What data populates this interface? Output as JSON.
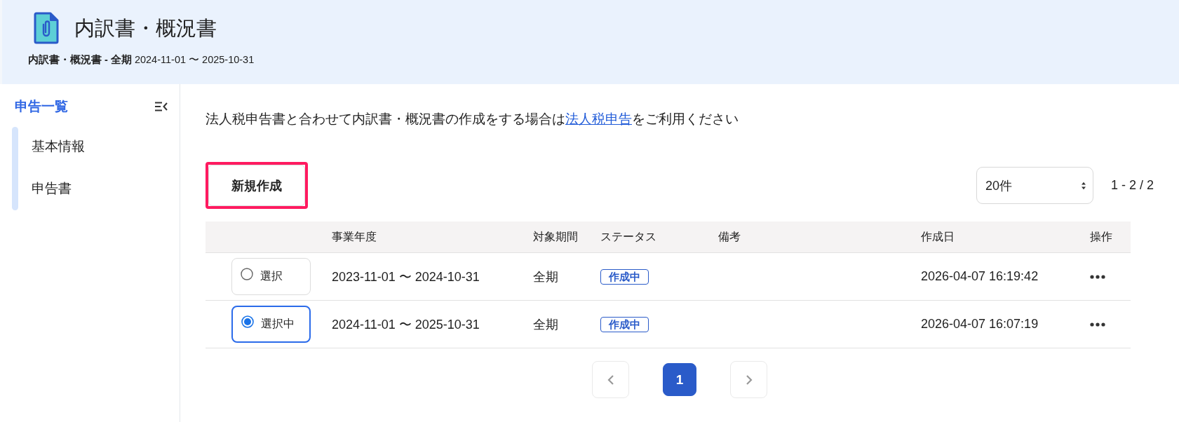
{
  "header": {
    "title": "内訳書・概況書",
    "subtitle": "**内訳書・概況書 - 全期** 2024-11-01 〜 2025-10-31"
  },
  "sidebar": {
    "title": "申告一覧",
    "items": [
      "基本情報",
      "申告書"
    ]
  },
  "notice": {
    "before": "法人税申告書と合わせて内訳書・概況書の作成をする場合は",
    "link": "法人税申告",
    "after": "をご利用ください"
  },
  "toolbar": {
    "new_button": {
      "label": "新規作成",
      "highlighted": true
    },
    "page_size": "20件",
    "range": "1 - 2 / 2"
  },
  "table": {
    "columns": [
      "事業年度",
      "対象期間",
      "ステータス",
      "備考",
      "作成日",
      "操作"
    ],
    "rows": [
      {
        "select_label": "選択",
        "selected": false,
        "fiscal_year": "2023-11-01 〜 2024-10-31",
        "period": "全期",
        "status": "作成中",
        "created": "2026-04-07 16:19:42"
      },
      {
        "select_label": "選択中",
        "selected": true,
        "fiscal_year": "2024-11-01 〜 2025-10-31",
        "period": "全期",
        "status": "作成中",
        "created": "2026-04-07 16:07:19"
      }
    ]
  },
  "pagination": {
    "prev": {
      "disabled": true
    },
    "pages": [
      {
        "label": "1",
        "selected": true
      }
    ],
    "next": {
      "disabled": true
    }
  }
}
